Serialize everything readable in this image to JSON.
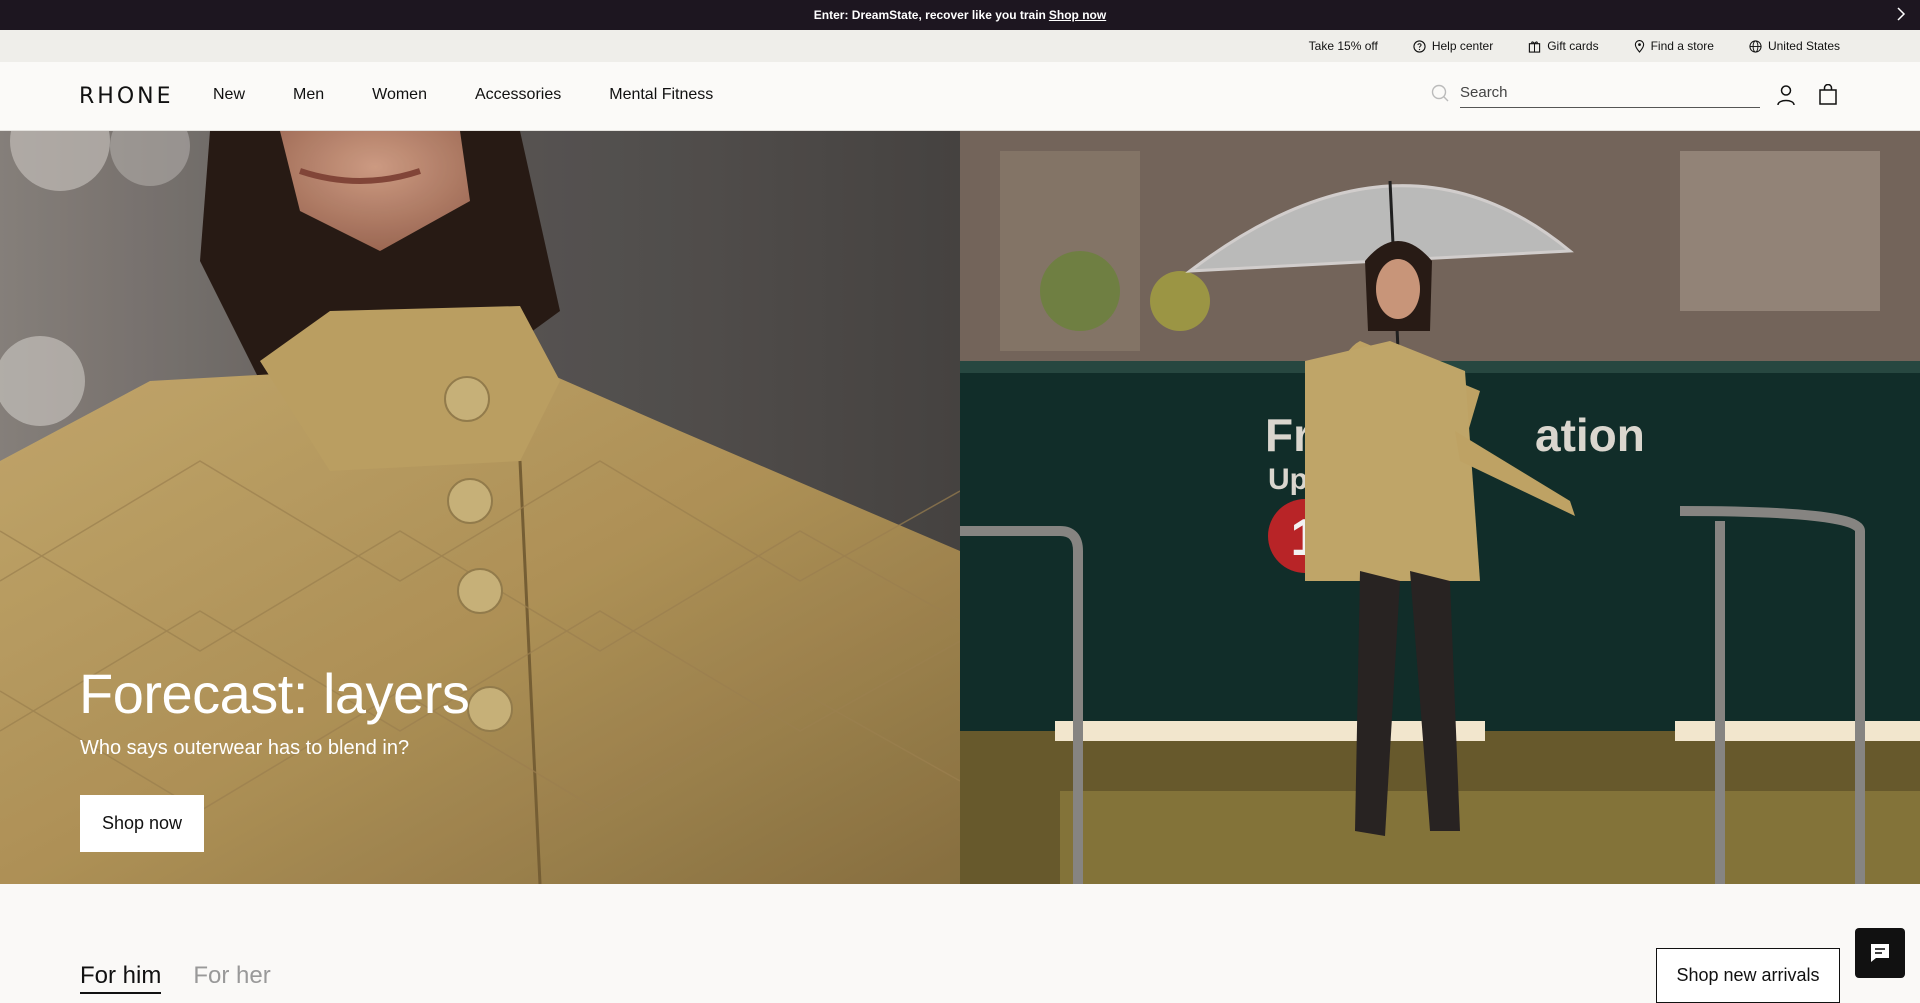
{
  "announcement": {
    "text": "Enter: DreamState, recover like you train",
    "link": "Shop now"
  },
  "utility": {
    "items": [
      {
        "label": "Take 15% off"
      },
      {
        "label": "Help center",
        "icon": "help-circle-icon"
      },
      {
        "label": "Gift cards",
        "icon": "gift-icon"
      },
      {
        "label": "Find a store",
        "icon": "map-pin-icon"
      },
      {
        "label": "United States",
        "icon": "globe-icon"
      }
    ]
  },
  "nav": {
    "logo": "RHONE",
    "menu": [
      "New",
      "Men",
      "Women",
      "Accessories",
      "Mental Fitness"
    ],
    "search_placeholder": "Search"
  },
  "hero": {
    "title": "Forecast: layers",
    "subtitle": "Who says outerwear has to blend in?",
    "button": "Shop now",
    "sign_line1": "Frank",
    "sign_line1b": "ation",
    "sign_line2": "Uptown",
    "sign_number": "1"
  },
  "section": {
    "tabs": [
      "For him",
      "For her"
    ],
    "cta": "Shop new arrivals"
  },
  "colors": {
    "announce_bg": "#1d1620",
    "utility_bg": "#efeeea",
    "jacket": "#c9ab6a"
  }
}
